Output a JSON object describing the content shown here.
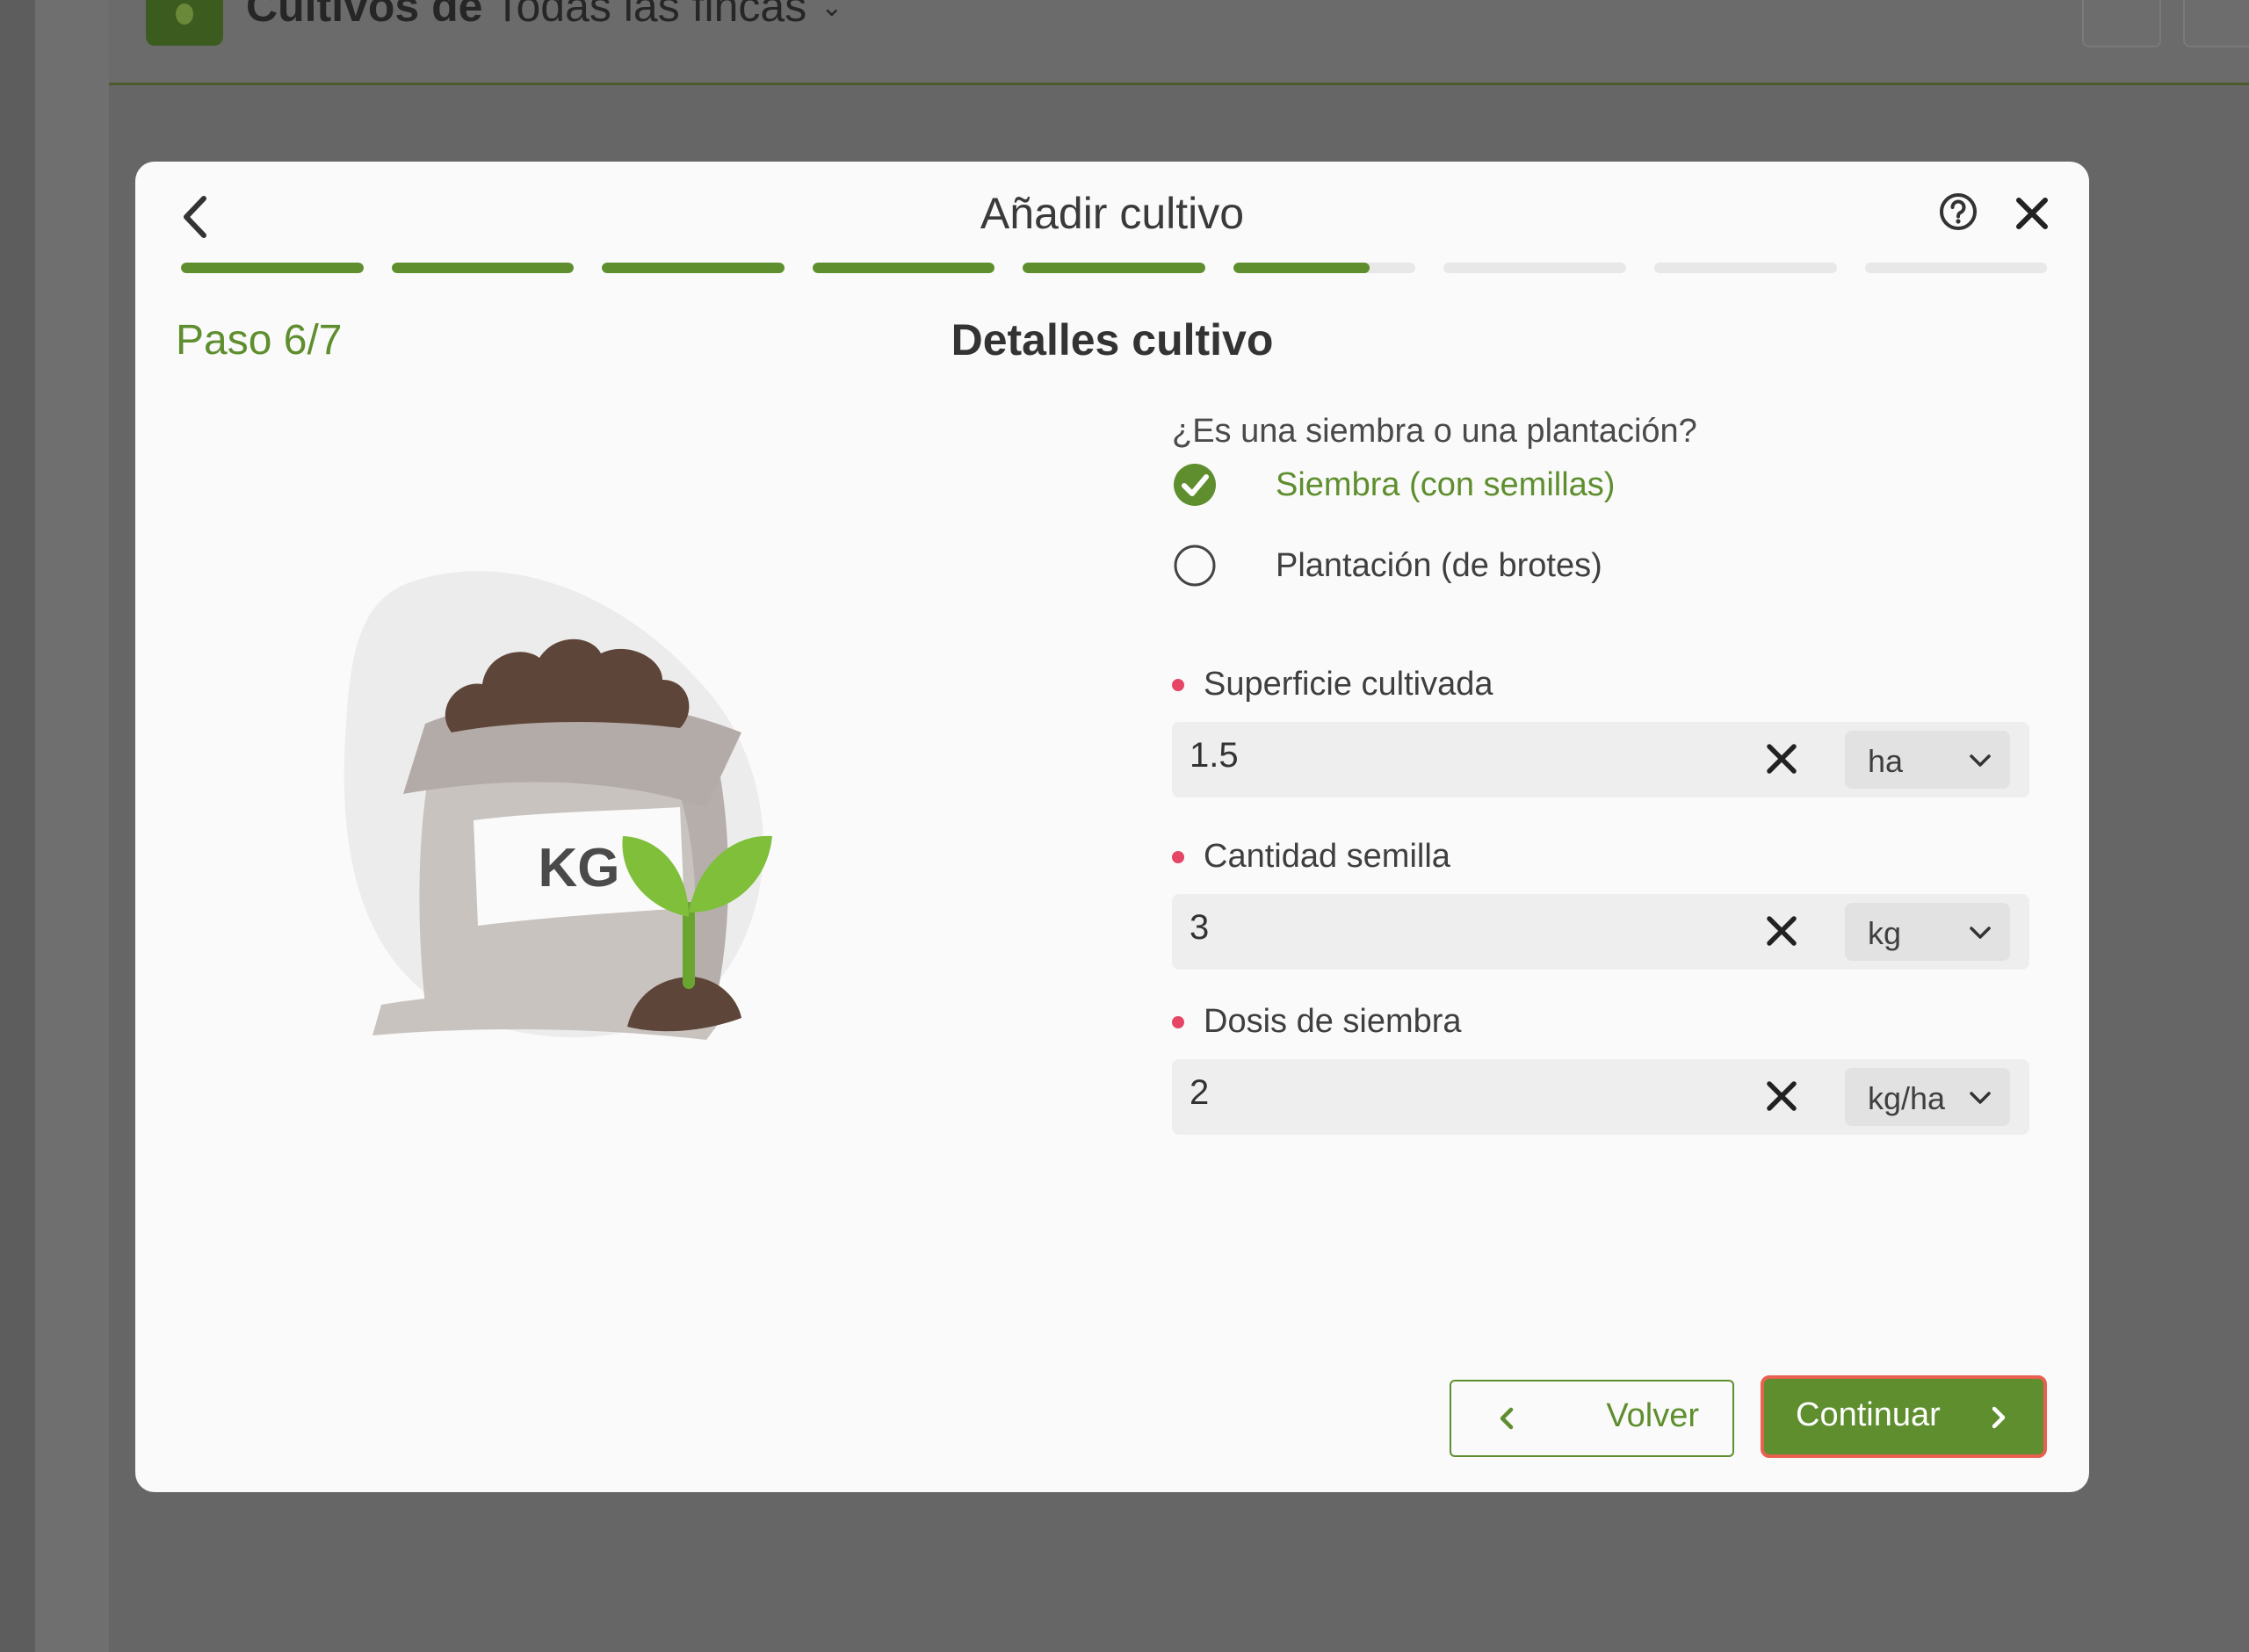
{
  "background": {
    "header_title_bold": "Cultivos de",
    "header_title_rest": "Todas las fincas"
  },
  "modal": {
    "title": "Añadir cultivo",
    "step_label": "Paso 6/7",
    "section_title": "Detalles cultivo",
    "progress": {
      "total_segments": 9,
      "completed_segments": 5,
      "current_segment_fill": 0.75
    },
    "illustration_text": "KG",
    "question": "¿Es una siembra o una plantación?",
    "options": [
      {
        "label": "Siembra (con semillas)",
        "selected": true
      },
      {
        "label": "Plantación (de brotes)",
        "selected": false
      }
    ],
    "fields": [
      {
        "label": "Superficie cultivada",
        "value": "1.5",
        "unit": "ha",
        "required": true
      },
      {
        "label": "Cantidad semilla",
        "value": "3",
        "unit": "kg",
        "required": true
      },
      {
        "label": "Dosis de siembra",
        "value": "2",
        "unit": "kg/ha",
        "required": true
      }
    ],
    "buttons": {
      "back_label": "Volver",
      "continue_label": "Continuar"
    }
  },
  "colors": {
    "accent": "#5e8e2e",
    "required_dot": "#e64566",
    "focus_outline": "#e8604f",
    "overlay": "#666666"
  }
}
